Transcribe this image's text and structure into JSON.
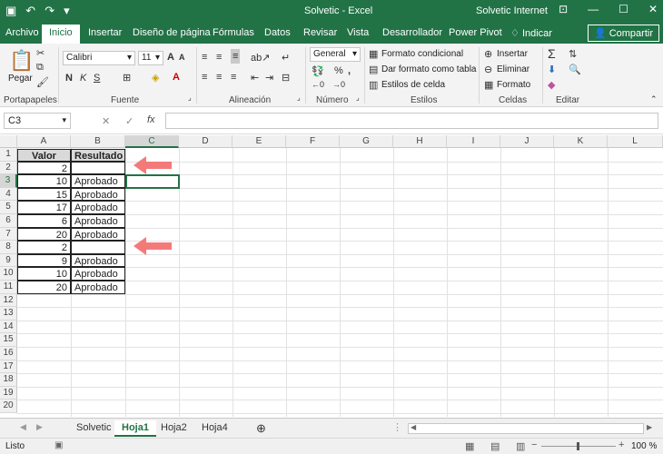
{
  "title": {
    "app": "Solvetic  -  Excel",
    "user": "Solvetic Internet"
  },
  "tabs": [
    "Archivo",
    "Inicio",
    "Insertar",
    "Diseño de página",
    "Fórmulas",
    "Datos",
    "Revisar",
    "Vista",
    "Desarrollador",
    "Power Pivot",
    "Indicar"
  ],
  "share": "Compartir",
  "ribbon": {
    "paste": "Pegar",
    "font_name": "Calibri",
    "font_size": "11",
    "number_format": "General",
    "cond_format": "Formato condicional",
    "table_format": "Dar formato como tabla",
    "cell_styles": "Estilos de celda",
    "insert": "Insertar",
    "delete": "Eliminar",
    "format": "Formato",
    "groups": [
      "Portapapeles",
      "Fuente",
      "Alineación",
      "Número",
      "Estilos",
      "Celdas",
      "Editar"
    ]
  },
  "namebox": "C3",
  "columns": [
    "A",
    "B",
    "C",
    "D",
    "E",
    "F",
    "G",
    "H",
    "I",
    "J",
    "K",
    "L"
  ],
  "rows": [
    "1",
    "2",
    "3",
    "4",
    "5",
    "6",
    "7",
    "8",
    "9",
    "10",
    "11",
    "12",
    "13",
    "14",
    "15",
    "16",
    "17",
    "18",
    "19",
    "20"
  ],
  "table": {
    "headers": [
      "Valor",
      "Resultado"
    ],
    "values": [
      "2",
      "10",
      "15",
      "17",
      "6",
      "20",
      "2",
      "9",
      "10",
      "20"
    ],
    "results": [
      "",
      "Aprobado",
      "Aprobado",
      "Aprobado",
      "Aprobado",
      "Aprobado",
      "",
      "Aprobado",
      "Aprobado",
      "Aprobado"
    ]
  },
  "sheets": [
    "Solvetic",
    "Hoja1",
    "Hoja2",
    "Hoja4"
  ],
  "status": {
    "ready": "Listo",
    "zoom": "100 %"
  },
  "colors": {
    "accent": "#217346",
    "arrow": "#f47a7a"
  }
}
